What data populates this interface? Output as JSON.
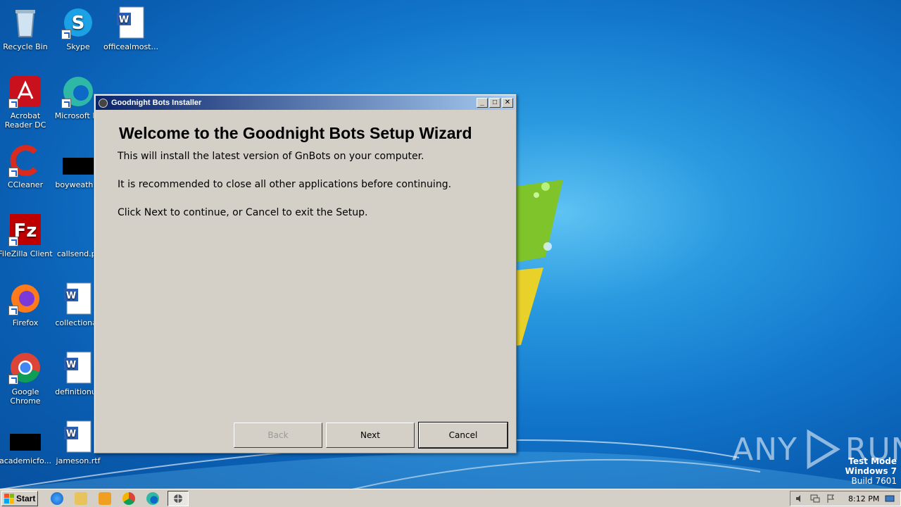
{
  "desktop": {
    "icons": [
      {
        "label": "Recycle Bin"
      },
      {
        "label": "Skype"
      },
      {
        "label": "officealmost..."
      },
      {
        "label": "Acrobat Reader DC"
      },
      {
        "label": "Microsoft Ec"
      },
      {
        "label": "CCleaner"
      },
      {
        "label": "boyweather"
      },
      {
        "label": "FileZilla Client"
      },
      {
        "label": "callsend.pr"
      },
      {
        "label": "Firefox"
      },
      {
        "label": "collectionas"
      },
      {
        "label": "Google Chrome"
      },
      {
        "label": "definitionun"
      },
      {
        "label": "academicfo..."
      },
      {
        "label": "jameson.rtf"
      }
    ],
    "watermark": "ANY RUN",
    "test_mode": {
      "line1": "Test Mode",
      "line2": "Windows 7",
      "line3": "Build 7601"
    }
  },
  "window": {
    "title": "Goodnight Bots Installer",
    "heading": "Welcome to the Goodnight Bots Setup Wizard",
    "paragraphs": [
      "This will install the latest version of GnBots on your computer.",
      "It is recommended to close all other applications before continuing.",
      "Click Next to continue, or Cancel to exit the Setup."
    ],
    "buttons": {
      "back": "Back",
      "next": "Next",
      "cancel": "Cancel"
    },
    "title_buttons": {
      "minimize": "_",
      "maximize": "□",
      "close": "✕"
    }
  },
  "taskbar": {
    "start_label": "Start",
    "clock": "8:12 PM"
  },
  "colors": {
    "titlebar_start": "#0a246a",
    "titlebar_end": "#a6caf0",
    "dialog_bg": "#d4d0c8"
  }
}
